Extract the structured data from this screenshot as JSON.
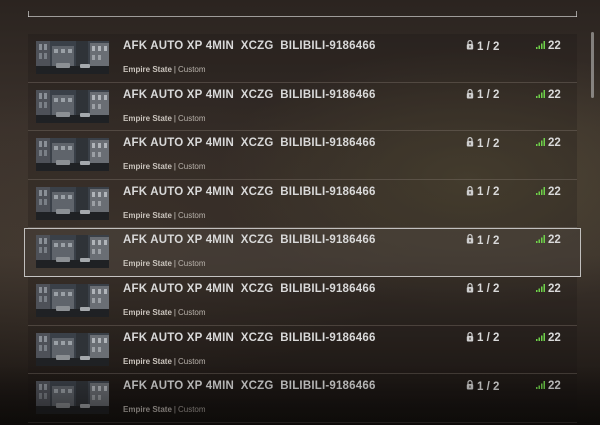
{
  "colors": {
    "text": "#d9d9d9",
    "meta_text": "#b8b2ab",
    "signal_green": "#6fd24a",
    "selection_border": "#d7d7d7"
  },
  "server_list": {
    "selected_index": 4,
    "rows": [
      {
        "name": "AFK AUTO XP 4MIN  XCZG  BILIBILI-9186466",
        "map": "Empire State",
        "mode": "Custom",
        "players": "1 / 2",
        "ping": "22",
        "ping_icon": "signal-bars-icon",
        "lock_icon": "lock-icon"
      },
      {
        "name": "AFK AUTO XP 4MIN  XCZG  BILIBILI-9186466",
        "map": "Empire State",
        "mode": "Custom",
        "players": "1 / 2",
        "ping": "22",
        "ping_icon": "signal-bars-icon",
        "lock_icon": "lock-icon"
      },
      {
        "name": "AFK AUTO XP 4MIN  XCZG  BILIBILI-9186466",
        "map": "Empire State",
        "mode": "Custom",
        "players": "1 / 2",
        "ping": "22",
        "ping_icon": "signal-bars-icon",
        "lock_icon": "lock-icon"
      },
      {
        "name": "AFK AUTO XP 4MIN  XCZG  BILIBILI-9186466",
        "map": "Empire State",
        "mode": "Custom",
        "players": "1 / 2",
        "ping": "22",
        "ping_icon": "signal-bars-icon",
        "lock_icon": "lock-icon"
      },
      {
        "name": "AFK AUTO XP 4MIN  XCZG  BILIBILI-9186466",
        "map": "Empire State",
        "mode": "Custom",
        "players": "1 / 2",
        "ping": "22",
        "ping_icon": "signal-bars-icon",
        "lock_icon": "lock-icon"
      },
      {
        "name": "AFK AUTO XP 4MIN  XCZG  BILIBILI-9186466",
        "map": "Empire State",
        "mode": "Custom",
        "players": "1 / 2",
        "ping": "22",
        "ping_icon": "signal-bars-icon",
        "lock_icon": "lock-icon"
      },
      {
        "name": "AFK AUTO XP 4MIN  XCZG  BILIBILI-9186466",
        "map": "Empire State",
        "mode": "Custom",
        "players": "1 / 2",
        "ping": "22",
        "ping_icon": "signal-bars-icon",
        "lock_icon": "lock-icon"
      },
      {
        "name": "AFK AUTO XP 4MIN  XCZG  BILIBILI-9186466",
        "map": "Empire State",
        "mode": "Custom",
        "players": "1 / 2",
        "ping": "22",
        "ping_icon": "signal-bars-icon",
        "lock_icon": "lock-icon"
      }
    ]
  }
}
